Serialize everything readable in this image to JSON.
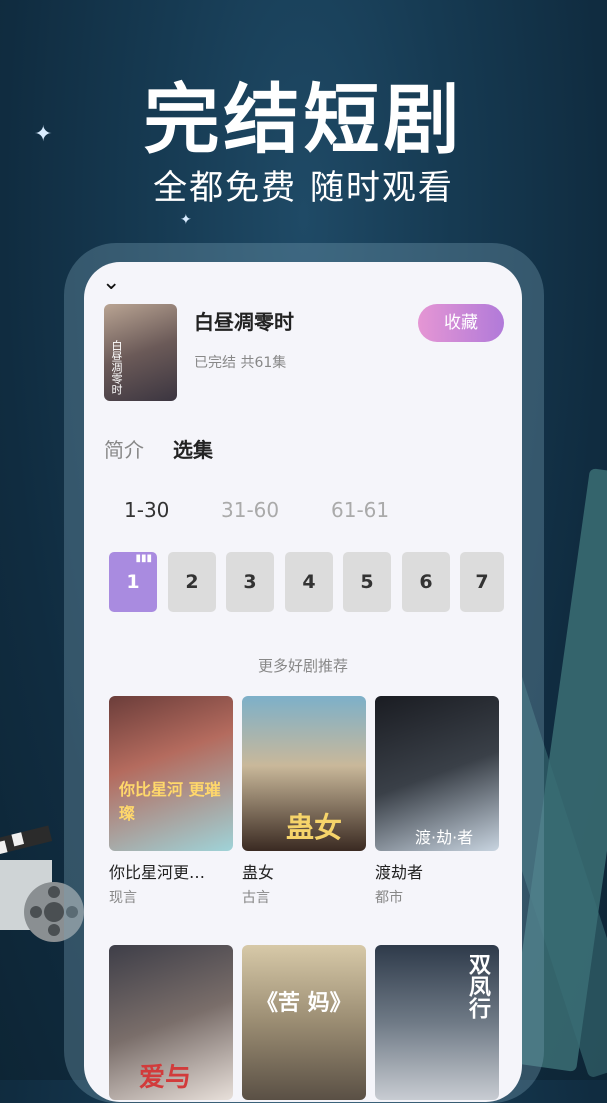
{
  "hero": {
    "title": "完结短剧",
    "subtitle": "全都免费 随时观看"
  },
  "detail": {
    "title": "白昼凋零时",
    "meta": "已完结 共61集",
    "favorite_label": "收藏",
    "cover_text": "白昼凋零时"
  },
  "tabs": [
    "简介",
    "选集"
  ],
  "ranges": [
    "1-30",
    "31-60",
    "61-61"
  ],
  "episodes": [
    "1",
    "2",
    "3",
    "4",
    "5",
    "6",
    "7"
  ],
  "current_episode": "1",
  "recommend": {
    "title": "更多好剧推荐",
    "items": [
      {
        "title": "你比星河更…",
        "genre": "现言",
        "poster_text": "你比星河 更璀璨"
      },
      {
        "title": "蛊女",
        "genre": "古言",
        "poster_text": "蛊女"
      },
      {
        "title": "渡劫者",
        "genre": "都市",
        "poster_text": "渡·劫·者"
      },
      {
        "poster_text": "爱与"
      },
      {
        "poster_text": "《苦 妈》"
      },
      {
        "poster_text": "双凤行"
      }
    ]
  },
  "colors": {
    "accent_purple": "#a98be0",
    "favorite_gradient_start": "#e596d4",
    "favorite_gradient_end": "#b17ad9",
    "background_dark": "#102c40"
  }
}
